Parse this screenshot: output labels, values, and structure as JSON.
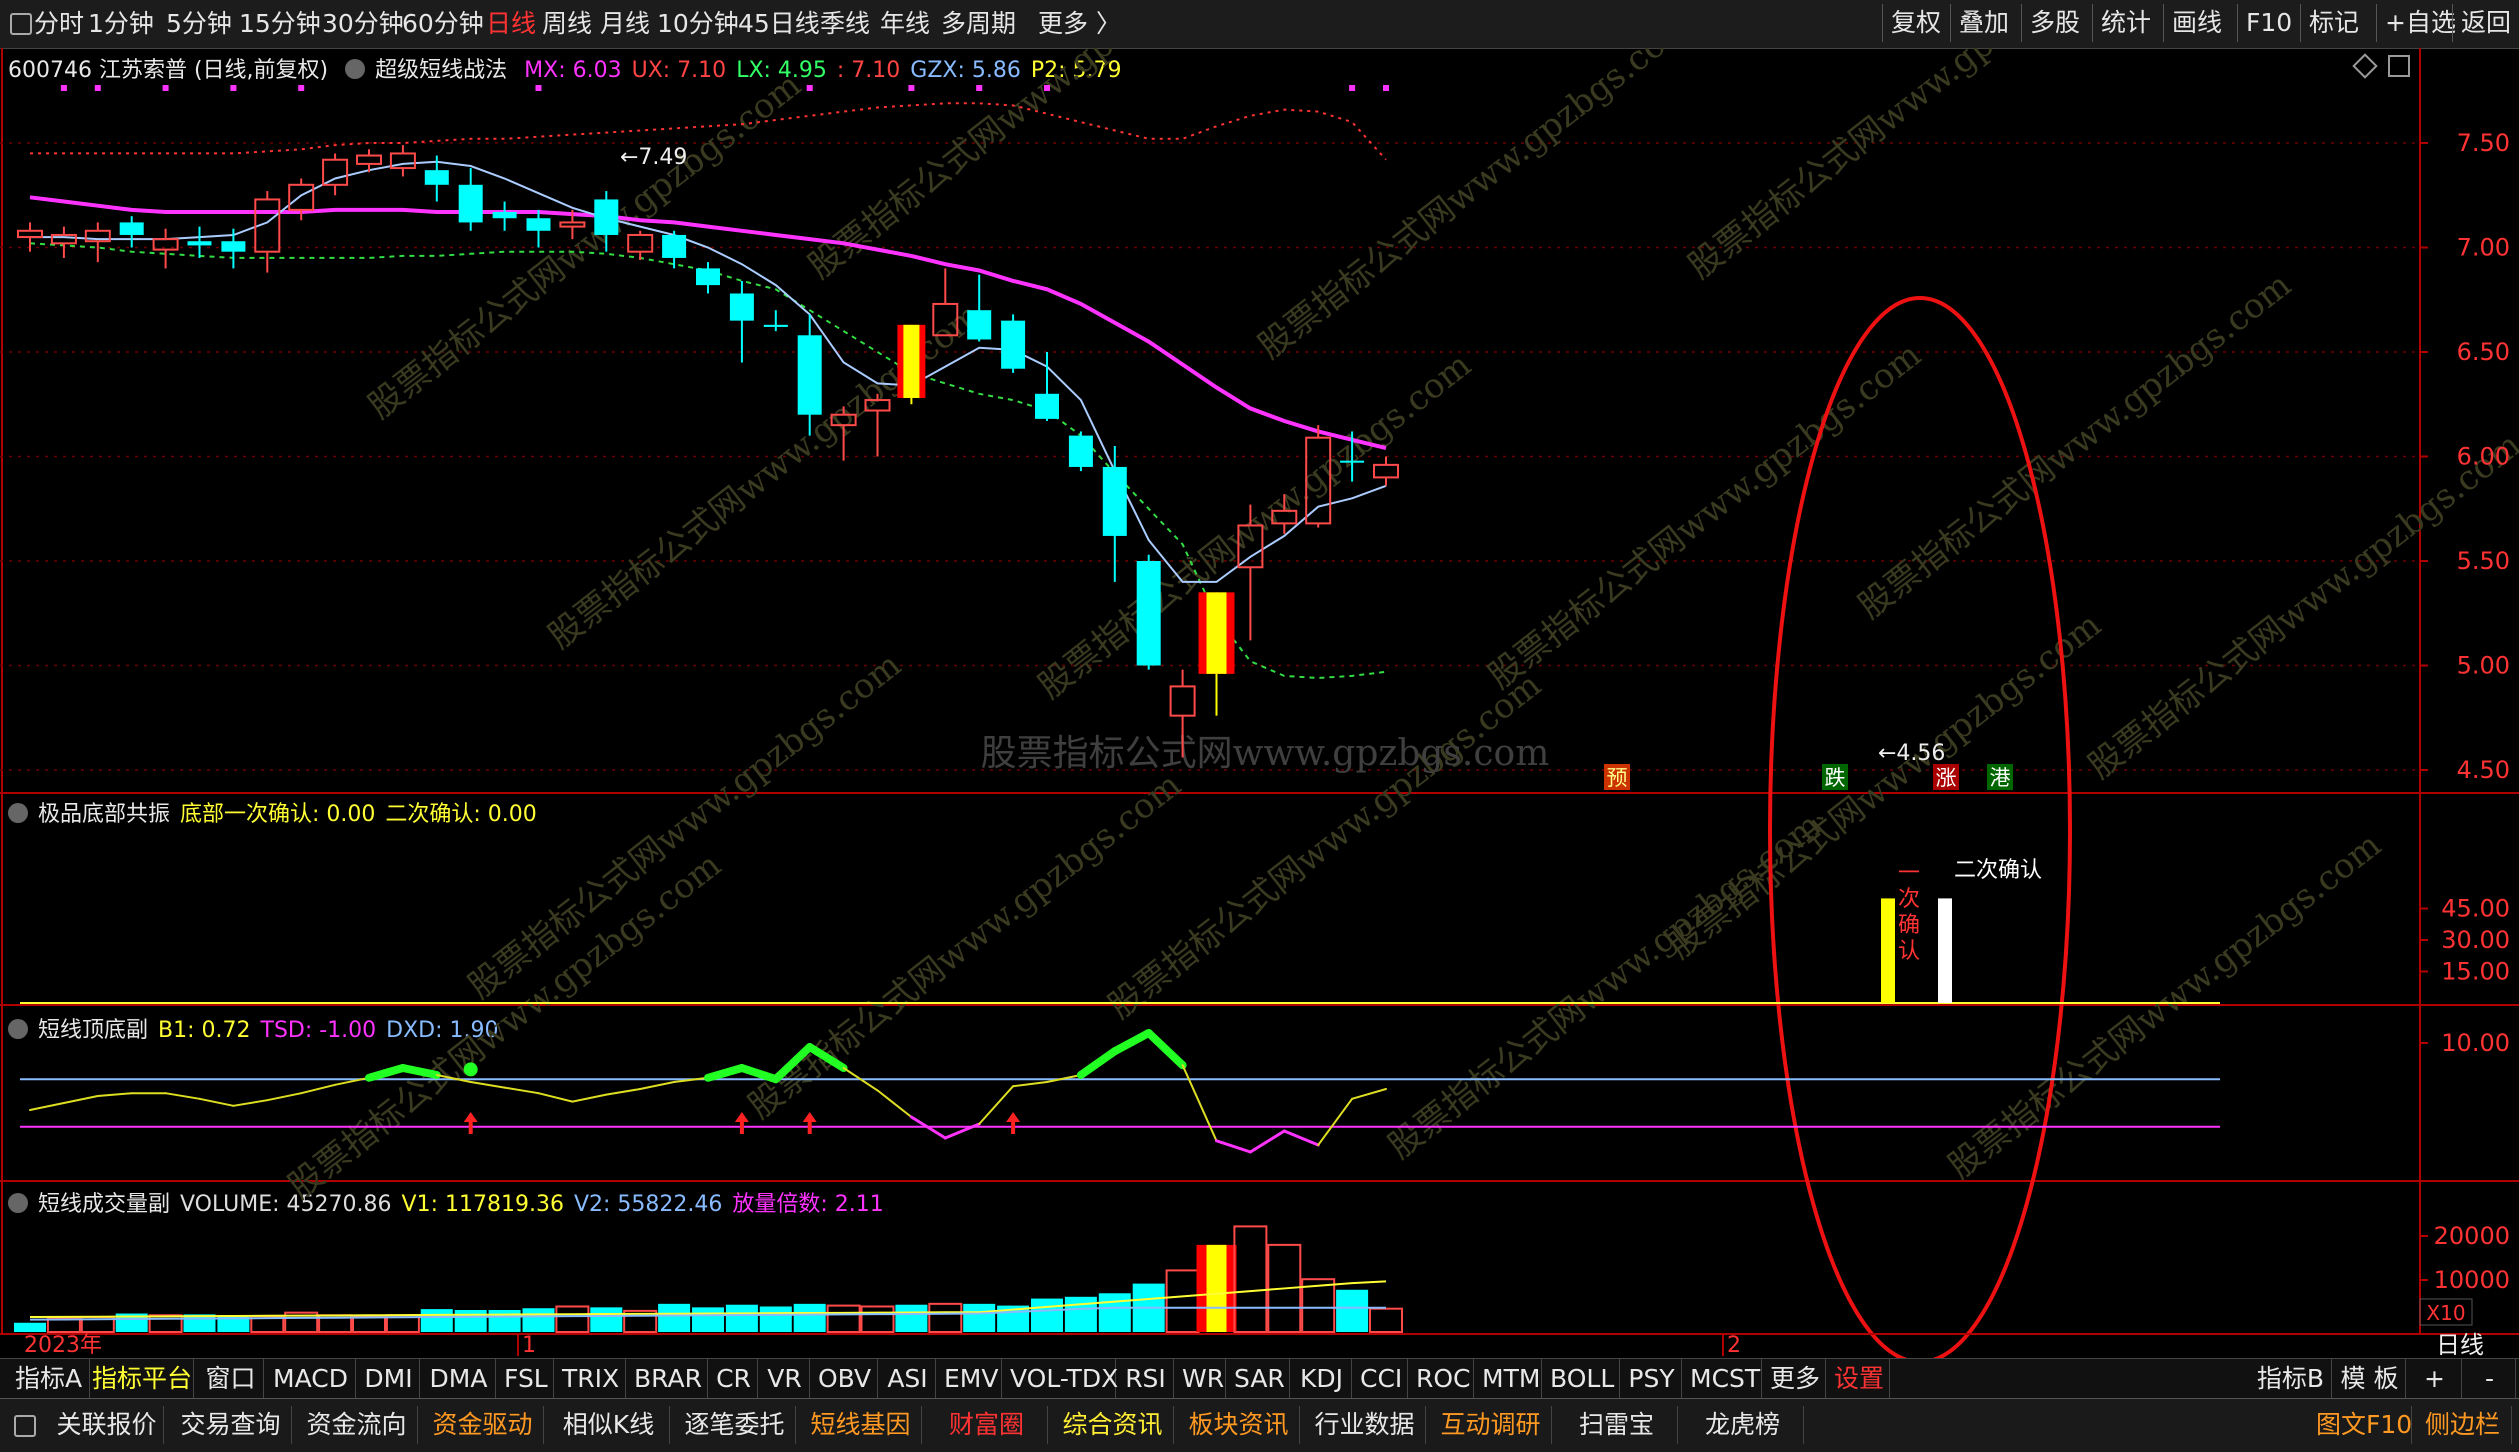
{
  "topbar": {
    "periods": [
      {
        "label": "分时",
        "active": false
      },
      {
        "label": "1分钟",
        "active": false
      },
      {
        "label": "5分钟",
        "active": false
      },
      {
        "label": "15分钟",
        "active": false
      },
      {
        "label": "30分钟",
        "active": false
      },
      {
        "label": "60分钟",
        "active": false
      },
      {
        "label": "日线",
        "active": true
      },
      {
        "label": "周线",
        "active": false
      },
      {
        "label": "月线",
        "active": false
      },
      {
        "label": "10分钟",
        "active": false
      },
      {
        "label": "45日线",
        "active": false
      },
      {
        "label": "季线",
        "active": false
      },
      {
        "label": "年线",
        "active": false
      },
      {
        "label": "多周期",
        "active": false
      },
      {
        "label": "更多 〉",
        "active": false
      }
    ],
    "tools": [
      "复权",
      "叠加",
      "多股",
      "统计",
      "画线",
      "F10",
      "标记",
      "+自选",
      "返回"
    ]
  },
  "main_header": {
    "stock": "600746 江苏索普 (日线,前复权)",
    "indicator": "超级短线战法",
    "values": [
      {
        "text": "MX: 6.03",
        "color": "#ff33ff"
      },
      {
        "text": "UX: 7.10",
        "color": "#ff4444"
      },
      {
        "text": "LX: 4.95",
        "color": "#33ff66"
      },
      {
        "text": ": 7.10",
        "color": "#ff4444"
      },
      {
        "text": "GZX: 5.86",
        "color": "#88bbff"
      },
      {
        "text": "P2: 5.79",
        "color": "#ffff33"
      }
    ]
  },
  "price_axis": [
    "7.50",
    "7.00",
    "6.50",
    "6.00",
    "5.50",
    "5.00",
    "4.50"
  ],
  "annotations": {
    "high": "←7.49",
    "low": "←4.56",
    "watermark": "股票指标公式网www.gpzbgs.com",
    "signals": [
      {
        "text": "预",
        "bg": "#cc3300",
        "fg": "#ffff88"
      },
      {
        "text": "跌",
        "bg": "#006600",
        "fg": "#ffffff"
      },
      {
        "text": "涨",
        "bg": "#aa0000",
        "fg": "#ffffff"
      },
      {
        "text": "港",
        "bg": "#006600",
        "fg": "#ffffff"
      }
    ]
  },
  "panel1": {
    "title": "极品底部共振",
    "values": [
      {
        "text": "底部一次确认: 0.00",
        "color": "#ffff33"
      },
      {
        "text": "二次确认: 0.00",
        "color": "#ffff33"
      }
    ],
    "axis": [
      "45.00",
      "30.00",
      "15.00"
    ],
    "label_first": "一次确认",
    "label_second": "二次确认"
  },
  "panel2": {
    "title": "短线顶底副",
    "values": [
      {
        "text": "B1: 0.72",
        "color": "#ffff33"
      },
      {
        "text": "TSD: -1.00",
        "color": "#ff33ff"
      },
      {
        "text": "DXD: 1.90",
        "color": "#88bbff"
      }
    ],
    "axis": [
      "10.00"
    ]
  },
  "panel3": {
    "title": "短线成交量副",
    "values": [
      {
        "text": "VOLUME: 45270.86",
        "color": "#dddddd"
      },
      {
        "text": "V1: 117819.36",
        "color": "#ffff33"
      },
      {
        "text": "V2: 55822.46",
        "color": "#88bbff"
      },
      {
        "text": "放量倍数: 2.11",
        "color": "#ff33ff"
      }
    ],
    "axis": [
      "20000",
      "10000"
    ],
    "unit": "X10"
  },
  "time_axis": {
    "year": "2023年",
    "m1": "1",
    "m2": "2",
    "period": "日线"
  },
  "chart_data": {
    "type": "candlestick",
    "title": "600746 江苏索普 (日线,前复权)",
    "ylim": [
      4.4,
      7.9
    ],
    "candles": [
      {
        "o": 7.05,
        "h": 7.12,
        "l": 6.98,
        "c": 7.08,
        "up": true
      },
      {
        "o": 7.02,
        "h": 7.1,
        "l": 6.95,
        "c": 7.06,
        "up": true
      },
      {
        "o": 7.03,
        "h": 7.12,
        "l": 6.93,
        "c": 7.08,
        "up": true
      },
      {
        "o": 7.06,
        "h": 7.15,
        "l": 7.0,
        "c": 7.12,
        "up": false
      },
      {
        "o": 6.99,
        "h": 7.09,
        "l": 6.9,
        "c": 7.04,
        "up": true
      },
      {
        "o": 7.01,
        "h": 7.1,
        "l": 6.95,
        "c": 7.03,
        "up": false
      },
      {
        "o": 7.03,
        "h": 7.09,
        "l": 6.9,
        "c": 6.98,
        "up": false
      },
      {
        "o": 6.98,
        "h": 7.27,
        "l": 6.88,
        "c": 7.23,
        "up": true
      },
      {
        "o": 7.18,
        "h": 7.33,
        "l": 7.13,
        "c": 7.3,
        "up": true
      },
      {
        "o": 7.3,
        "h": 7.45,
        "l": 7.25,
        "c": 7.42,
        "up": true
      },
      {
        "o": 7.4,
        "h": 7.47,
        "l": 7.36,
        "c": 7.44,
        "up": true
      },
      {
        "o": 7.38,
        "h": 7.49,
        "l": 7.34,
        "c": 7.45,
        "up": true
      },
      {
        "o": 7.37,
        "h": 7.44,
        "l": 7.22,
        "c": 7.3,
        "up": false
      },
      {
        "o": 7.3,
        "h": 7.38,
        "l": 7.08,
        "c": 7.12,
        "up": false
      },
      {
        "o": 7.17,
        "h": 7.22,
        "l": 7.08,
        "c": 7.14,
        "up": false
      },
      {
        "o": 7.14,
        "h": 7.18,
        "l": 7.0,
        "c": 7.08,
        "up": false
      },
      {
        "o": 7.1,
        "h": 7.18,
        "l": 7.04,
        "c": 7.12,
        "up": true
      },
      {
        "o": 7.23,
        "h": 7.27,
        "l": 6.98,
        "c": 7.06,
        "up": false
      },
      {
        "o": 6.98,
        "h": 7.08,
        "l": 6.94,
        "c": 7.06,
        "up": true
      },
      {
        "o": 7.06,
        "h": 7.08,
        "l": 6.9,
        "c": 6.95,
        "up": false
      },
      {
        "o": 6.9,
        "h": 6.93,
        "l": 6.78,
        "c": 6.82,
        "up": false
      },
      {
        "o": 6.78,
        "h": 6.84,
        "l": 6.45,
        "c": 6.65,
        "up": false
      },
      {
        "o": 6.63,
        "h": 6.7,
        "l": 6.6,
        "c": 6.62,
        "up": false
      },
      {
        "o": 6.58,
        "h": 6.68,
        "l": 6.1,
        "c": 6.2,
        "up": false
      },
      {
        "o": 6.15,
        "h": 6.24,
        "l": 5.98,
        "c": 6.2,
        "up": true
      },
      {
        "o": 6.22,
        "h": 6.3,
        "l": 6.0,
        "c": 6.27,
        "up": true
      },
      {
        "o": 6.28,
        "h": 6.63,
        "l": 6.25,
        "c": 6.63,
        "up": false,
        "marker": true
      },
      {
        "o": 6.58,
        "h": 6.9,
        "l": 6.58,
        "c": 6.73,
        "up": true
      },
      {
        "o": 6.7,
        "h": 6.87,
        "l": 6.55,
        "c": 6.56,
        "up": false
      },
      {
        "o": 6.65,
        "h": 6.68,
        "l": 6.4,
        "c": 6.42,
        "up": false
      },
      {
        "o": 6.3,
        "h": 6.5,
        "l": 6.17,
        "c": 6.18,
        "up": false
      },
      {
        "o": 6.1,
        "h": 6.12,
        "l": 5.93,
        "c": 5.95,
        "up": false
      },
      {
        "o": 5.95,
        "h": 6.05,
        "l": 5.4,
        "c": 5.62,
        "up": false
      },
      {
        "o": 5.5,
        "h": 5.53,
        "l": 4.98,
        "c": 5.0,
        "up": false
      },
      {
        "o": 4.9,
        "h": 4.98,
        "l": 4.56,
        "c": 4.76,
        "up": true
      },
      {
        "o": 4.96,
        "h": 5.35,
        "l": 4.76,
        "c": 5.35,
        "up": false,
        "marker": true
      },
      {
        "o": 5.47,
        "h": 5.77,
        "l": 5.12,
        "c": 5.67,
        "up": true
      },
      {
        "o": 5.68,
        "h": 5.82,
        "l": 5.63,
        "c": 5.74,
        "up": true
      },
      {
        "o": 5.68,
        "h": 6.15,
        "l": 5.66,
        "c": 6.09,
        "up": true
      },
      {
        "o": 5.98,
        "h": 6.12,
        "l": 5.88,
        "c": 5.98,
        "up": false
      },
      {
        "o": 5.9,
        "h": 6.0,
        "l": 5.86,
        "c": 5.96,
        "up": true
      }
    ],
    "series": [
      {
        "name": "MX",
        "color": "#ff33ff",
        "style": "thick",
        "values": [
          7.24,
          7.22,
          7.2,
          7.18,
          7.17,
          7.17,
          7.17,
          7.17,
          7.17,
          7.18,
          7.18,
          7.18,
          7.17,
          7.17,
          7.17,
          7.17,
          7.16,
          7.15,
          7.13,
          7.12,
          7.1,
          7.08,
          7.06,
          7.04,
          7.02,
          6.99,
          6.96,
          6.92,
          6.89,
          6.84,
          6.8,
          6.73,
          6.64,
          6.55,
          6.44,
          6.33,
          6.23,
          6.17,
          6.12,
          6.08,
          6.04
        ]
      },
      {
        "name": "UX",
        "color": "#ff3333",
        "style": "dotted",
        "values": [
          7.45,
          7.45,
          7.45,
          7.45,
          7.45,
          7.45,
          7.45,
          7.46,
          7.47,
          7.49,
          7.5,
          7.5,
          7.51,
          7.52,
          7.52,
          7.53,
          7.54,
          7.55,
          7.56,
          7.57,
          7.58,
          7.59,
          7.61,
          7.63,
          7.65,
          7.67,
          7.68,
          7.69,
          7.69,
          7.68,
          7.64,
          7.6,
          7.56,
          7.52,
          7.52,
          7.58,
          7.63,
          7.66,
          7.65,
          7.6,
          7.42
        ]
      },
      {
        "name": "LX",
        "color": "#33dd44",
        "style": "dashed",
        "values": [
          7.02,
          7.01,
          7.0,
          6.98,
          6.97,
          6.96,
          6.95,
          6.95,
          6.95,
          6.95,
          6.95,
          6.96,
          6.96,
          6.97,
          6.98,
          6.98,
          6.98,
          6.97,
          6.95,
          6.92,
          6.89,
          6.84,
          6.8,
          6.7,
          6.6,
          6.5,
          6.4,
          6.35,
          6.3,
          6.27,
          6.22,
          6.1,
          5.92,
          5.75,
          5.58,
          5.23,
          5.02,
          4.95,
          4.94,
          4.95,
          4.97
        ]
      },
      {
        "name": "GZX",
        "color": "#aaccff",
        "style": "thin",
        "values": [
          7.05,
          7.05,
          7.04,
          7.04,
          7.04,
          7.05,
          7.06,
          7.12,
          7.25,
          7.33,
          7.37,
          7.4,
          7.41,
          7.39,
          7.33,
          7.26,
          7.19,
          7.14,
          7.1,
          7.06,
          7.0,
          6.92,
          6.82,
          6.68,
          6.45,
          6.35,
          6.34,
          6.43,
          6.52,
          6.51,
          6.43,
          6.27,
          5.93,
          5.6,
          5.4,
          5.4,
          5.52,
          5.62,
          5.76,
          5.8,
          5.86
        ]
      }
    ],
    "volume": [
      0.21,
      0.32,
      0.34,
      0.42,
      0.38,
      0.4,
      0.38,
      0.36,
      0.44,
      0.38,
      0.36,
      0.38,
      0.52,
      0.5,
      0.5,
      0.54,
      0.58,
      0.56,
      0.48,
      0.64,
      0.56,
      0.62,
      0.58,
      0.64,
      0.6,
      0.58,
      0.62,
      0.64,
      0.64,
      0.6,
      0.76,
      0.8,
      0.88,
      1.1,
      1.4,
      1.98,
      2.4,
      1.98,
      1.2,
      0.96,
      0.53
    ],
    "volume_up": [
      false,
      true,
      true,
      false,
      true,
      false,
      false,
      true,
      true,
      true,
      true,
      true,
      false,
      false,
      false,
      false,
      true,
      false,
      true,
      false,
      false,
      false,
      false,
      false,
      true,
      true,
      false,
      true,
      false,
      false,
      false,
      false,
      false,
      false,
      true,
      false,
      true,
      true,
      true,
      false,
      true
    ],
    "volume_v1": 1.15,
    "volume_v2": 0.55,
    "panel1_first_confirm": 46,
    "panel1_second_confirm": 46,
    "panel2_line": [
      2.0,
      2.5,
      3.0,
      3.2,
      3.2,
      2.8,
      2.3,
      2.7,
      3.2,
      3.8,
      4.3,
      5.0,
      4.5,
      4.0,
      3.6,
      3.2,
      2.6,
      3.1,
      3.5,
      4.0,
      4.3,
      5.0,
      4.2,
      6.5,
      5.0,
      3.4,
      1.5,
      0.0,
      1.0,
      3.7,
      4.0,
      4.5,
      6.2,
      7.5,
      5.2,
      -0.2,
      -1.0,
      0.5,
      -0.5,
      2.8,
      3.5
    ],
    "panel2_levels": [
      4.2,
      0.8
    ]
  }
}
